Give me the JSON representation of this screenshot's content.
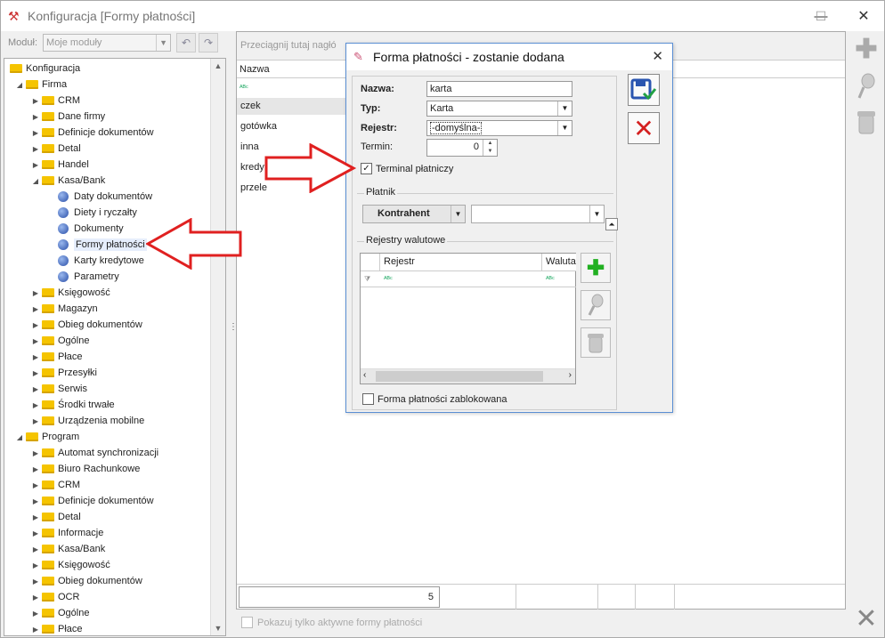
{
  "window": {
    "title": "Konfiguracja [Formy płatności]",
    "minimize_glyph": "—",
    "maximize_glyph": "☐",
    "close_glyph": "✕"
  },
  "module_bar": {
    "label": "Moduł:",
    "selected": "Moje moduły"
  },
  "tree": {
    "items": [
      {
        "label": "Konfiguracja",
        "level": 0,
        "kind": "folder",
        "expanded": true
      },
      {
        "label": "Firma",
        "level": 1,
        "kind": "folder",
        "expanded": true
      },
      {
        "label": "CRM",
        "level": 2,
        "kind": "folder"
      },
      {
        "label": "Dane firmy",
        "level": 2,
        "kind": "folder"
      },
      {
        "label": "Definicje dokumentów",
        "level": 2,
        "kind": "folder"
      },
      {
        "label": "Detal",
        "level": 2,
        "kind": "folder"
      },
      {
        "label": "Handel",
        "level": 2,
        "kind": "folder"
      },
      {
        "label": "Kasa/Bank",
        "level": 2,
        "kind": "folder",
        "expanded": true
      },
      {
        "label": "Daty dokumentów",
        "level": 3,
        "kind": "leaf"
      },
      {
        "label": "Diety i ryczałty",
        "level": 3,
        "kind": "leaf"
      },
      {
        "label": "Dokumenty",
        "level": 3,
        "kind": "leaf"
      },
      {
        "label": "Formy płatności",
        "level": 3,
        "kind": "leaf",
        "selected": true
      },
      {
        "label": "Karty kredytowe",
        "level": 3,
        "kind": "leaf"
      },
      {
        "label": "Parametry",
        "level": 3,
        "kind": "leaf"
      },
      {
        "label": "Księgowość",
        "level": 2,
        "kind": "folder"
      },
      {
        "label": "Magazyn",
        "level": 2,
        "kind": "folder"
      },
      {
        "label": "Obieg dokumentów",
        "level": 2,
        "kind": "folder"
      },
      {
        "label": "Ogólne",
        "level": 2,
        "kind": "folder"
      },
      {
        "label": "Płace",
        "level": 2,
        "kind": "folder"
      },
      {
        "label": "Przesyłki",
        "level": 2,
        "kind": "folder"
      },
      {
        "label": "Serwis",
        "level": 2,
        "kind": "folder"
      },
      {
        "label": "Środki trwałe",
        "level": 2,
        "kind": "folder"
      },
      {
        "label": "Urządzenia mobilne",
        "level": 2,
        "kind": "folder"
      },
      {
        "label": "Program",
        "level": 1,
        "kind": "folder",
        "expanded": true
      },
      {
        "label": "Automat synchronizacji",
        "level": 2,
        "kind": "folder"
      },
      {
        "label": "Biuro Rachunkowe",
        "level": 2,
        "kind": "folder"
      },
      {
        "label": "CRM",
        "level": 2,
        "kind": "folder"
      },
      {
        "label": "Definicje dokumentów",
        "level": 2,
        "kind": "folder"
      },
      {
        "label": "Detal",
        "level": 2,
        "kind": "folder"
      },
      {
        "label": "Informacje",
        "level": 2,
        "kind": "folder"
      },
      {
        "label": "Kasa/Bank",
        "level": 2,
        "kind": "folder"
      },
      {
        "label": "Księgowość",
        "level": 2,
        "kind": "folder"
      },
      {
        "label": "Obieg dokumentów",
        "level": 2,
        "kind": "folder"
      },
      {
        "label": "OCR",
        "level": 2,
        "kind": "folder"
      },
      {
        "label": "Ogólne",
        "level": 2,
        "kind": "folder"
      },
      {
        "label": "Płace",
        "level": 2,
        "kind": "folder"
      }
    ]
  },
  "main": {
    "group_hint": "Przeciągnij tutaj nagłó",
    "column": "Nazwa",
    "rows": [
      "czek",
      "gotówka",
      "inna",
      "kredy",
      "przele"
    ],
    "count": "5",
    "only_active_label": "Pokazuj tylko aktywne formy płatności"
  },
  "dialog": {
    "title": "Forma płatności - zostanie dodana",
    "nazwa_label": "Nazwa:",
    "nazwa_value": "karta",
    "typ_label": "Typ:",
    "typ_value": "Karta",
    "rejestr_label": "Rejestr:",
    "rejestr_value": "-domyślna-",
    "termin_label": "Termin:",
    "termin_value": "0",
    "terminal_label": "Terminal płatniczy",
    "terminal_checked": true,
    "platnik_group": "Płatnik",
    "platnik_type": "Kontrahent",
    "platnik_value": "",
    "rejestry_group": "Rejestry walutowe",
    "grid_col_rejestr": "Rejestr",
    "grid_col_waluta": "Waluta",
    "blocked_label": "Forma płatności zablokowana",
    "blocked_checked": false
  },
  "colors": {
    "annotation_arrow": "#e02020",
    "folder": "#f5c400",
    "dialog_border": "#5b8fd4",
    "save_icon": "#2a55b0",
    "cancel_icon": "#d42020",
    "add_icon": "#22b022"
  }
}
